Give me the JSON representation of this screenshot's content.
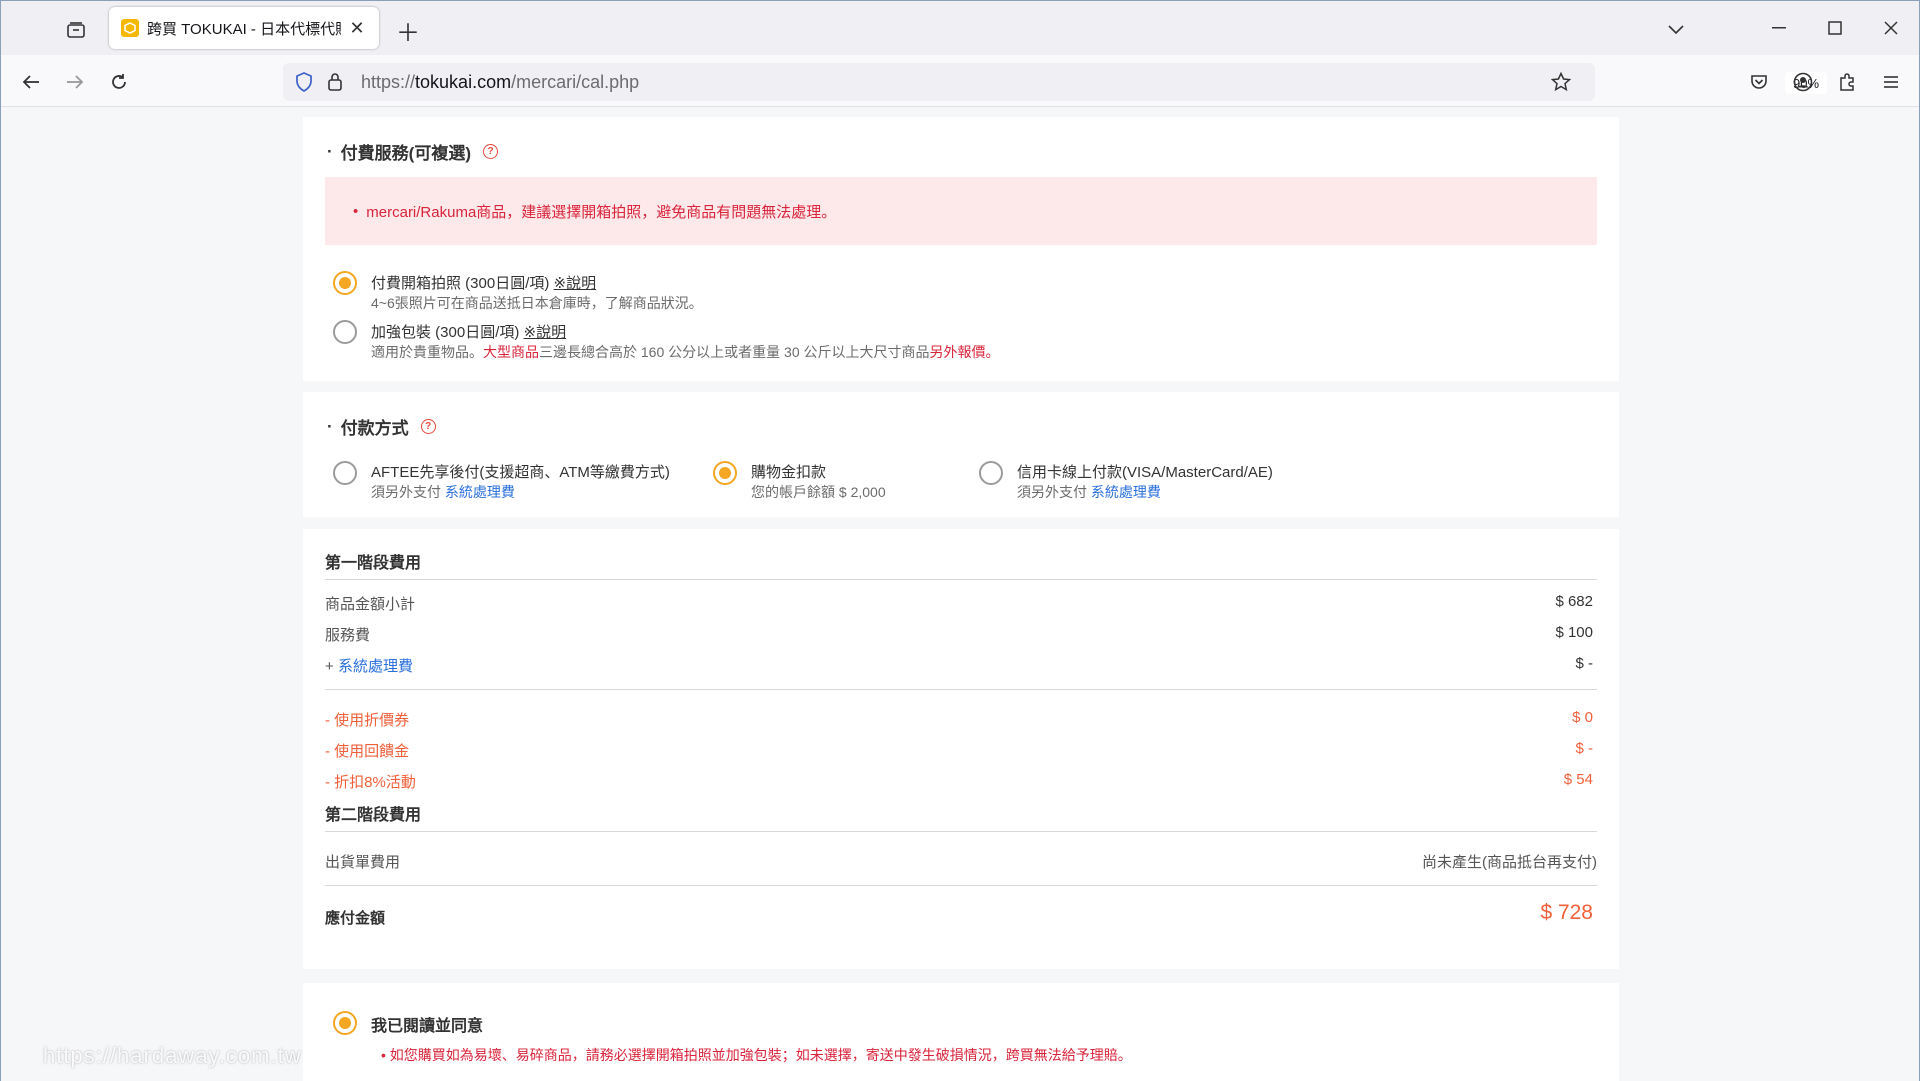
{
  "browser": {
    "tab_title": "跨買 TOKUKAI - 日本代標代購",
    "url_host": "tokukai.com",
    "url_scheme": "https://",
    "url_path": "/mercari/cal.php",
    "zoom": "90%"
  },
  "paid_services": {
    "title": "付費服務(可複選)",
    "alert": "mercari/Rakuma商品，建議選擇開箱拍照，避免商品有問題無法處理。",
    "options": [
      {
        "label": "付費開箱拍照 (300日圓/項)",
        "link": "※說明",
        "sub": "4~6張照片可在商品送抵日本倉庫時，了解商品狀況。",
        "selected": true
      },
      {
        "label": "加強包裝 (300日圓/項)",
        "link": "※說明",
        "sub_a": "適用於貴重物品。",
        "sub_b": "大型商品",
        "sub_c": "三邊長總合高於 160 公分以上或者重量 30 公斤以上大尺寸商品",
        "sub_d": "另外報價",
        "sub_e": "。",
        "selected": false
      }
    ]
  },
  "payment": {
    "title": "付款方式",
    "options": [
      {
        "label": "AFTEE先享後付(支援超商、ATM等繳費方式)",
        "sub_a": "須另外支付 ",
        "sub_link": "系統處理費",
        "selected": false
      },
      {
        "label": "購物金扣款",
        "sub_a": "您的帳戶餘額 $ 2,000",
        "selected": true
      },
      {
        "label": "信用卡線上付款(VISA/MasterCard/AE)",
        "sub_a": "須另外支付 ",
        "sub_link": "系統處理費",
        "selected": false
      }
    ]
  },
  "fees": {
    "stage1_title": "第一階段費用",
    "rows": [
      {
        "label": "商品金額小計",
        "value": "$ 682"
      },
      {
        "label": "服務費",
        "value": "$ 100"
      },
      {
        "label_prefix": "+ ",
        "label": "系統處理費",
        "value": "$ -"
      }
    ],
    "discounts": [
      {
        "label": "- 使用折價券",
        "value": "$ 0"
      },
      {
        "label": "- 使用回饋金",
        "value": "$ -"
      },
      {
        "label": "- 折扣8%活動",
        "value": "$ 54"
      }
    ],
    "stage2_title": "第二階段費用",
    "shipping_label": "出貨單費用",
    "shipping_value": "尚未產生(商品抵台再支付)",
    "total_label": "應付金額",
    "total_value": "$ 728"
  },
  "agreement": {
    "label": "我已閱讀並同意",
    "selected": true,
    "note": "如您購買如為易壞、易碎商品，請務必選擇開箱拍照並加強包裝；如未選擇，寄送中發生破損情況，跨買無法給予理賠。"
  },
  "watermark": "https://hardaway.com.tw"
}
